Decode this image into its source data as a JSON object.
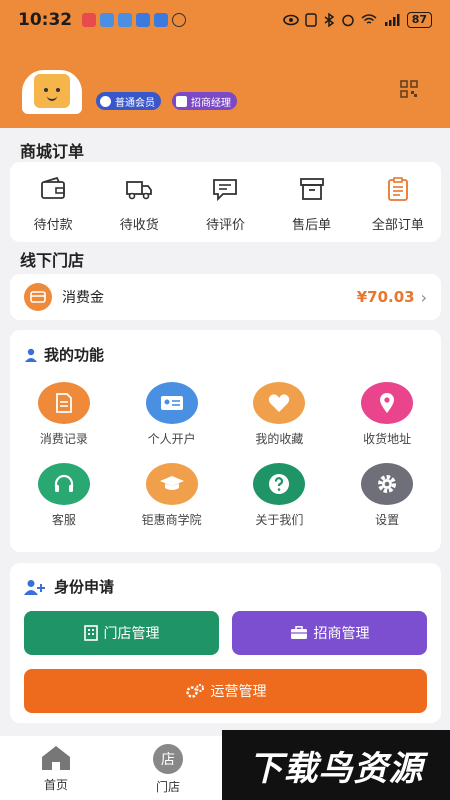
{
  "status_bar": {
    "time": "10:32",
    "battery": "87"
  },
  "header": {
    "badges": {
      "member": "普通会员",
      "manager": "招商经理"
    },
    "colors": {
      "background": "#ee8b3a"
    }
  },
  "mall_orders": {
    "title": "商城订单",
    "items": [
      {
        "label": "待付款",
        "icon": "wallet-icon"
      },
      {
        "label": "待收货",
        "icon": "truck-icon"
      },
      {
        "label": "待评价",
        "icon": "comment-icon"
      },
      {
        "label": "售后单",
        "icon": "box-icon"
      },
      {
        "label": "全部订单",
        "icon": "clipboard-icon"
      }
    ]
  },
  "offline_store": {
    "title": "线下门店",
    "consume_label": "消费金",
    "consume_amount": "¥70.03"
  },
  "functions": {
    "title": "我的功能",
    "items": [
      {
        "label": "消费记录",
        "icon": "document-icon",
        "color": "#f08a3b"
      },
      {
        "label": "个人开户",
        "icon": "id-card-icon",
        "color": "#4a90e2"
      },
      {
        "label": "我的收藏",
        "icon": "heart-icon",
        "color": "#f0a04b"
      },
      {
        "label": "收货地址",
        "icon": "location-icon",
        "color": "#e9448c"
      },
      {
        "label": "客服",
        "icon": "headset-icon",
        "color": "#2aa871"
      },
      {
        "label": "钜惠商学院",
        "icon": "graduation-cap-icon",
        "color": "#f0a04b"
      },
      {
        "label": "关于我们",
        "icon": "question-icon",
        "color": "#1f9466"
      },
      {
        "label": "设置",
        "icon": "gear-icon",
        "color": "#6f6f7a"
      }
    ]
  },
  "identity": {
    "title": "身份申请",
    "store_button": "门店管理",
    "invest_button": "招商管理",
    "ops_button": "运营管理"
  },
  "bottom_nav": {
    "home": "首页",
    "store": "门店",
    "store_icon_char": "店"
  },
  "watermark": "下载鸟资源"
}
